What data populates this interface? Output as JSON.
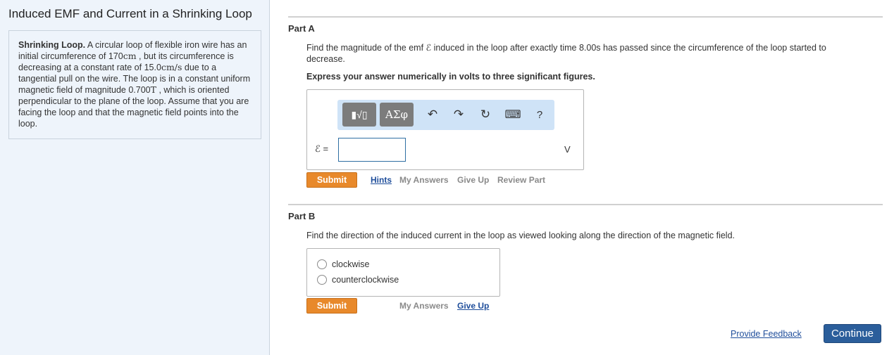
{
  "title": "Induced EMF and Current in a Shrinking Loop",
  "intro": {
    "lead": "Shrinking Loop.",
    "text1": " A circular loop of flexible iron wire has an initial circumference of ",
    "circ_value": "170",
    "circ_unit": "cm",
    "text2": " , but its circumference is decreasing at a constant rate of ",
    "rate_value": "15.0",
    "rate_unit": "cm/s",
    "text3": " due to a tangential pull on the wire. The loop is in a constant uniform magnetic field of magnitude ",
    "field_value": "0.700",
    "field_unit": "T",
    "text4": " , which is oriented perpendicular to the plane of the loop. Assume that you are facing the loop and that the magnetic field points into the loop."
  },
  "partA": {
    "title": "Part A",
    "prompt": "Find the magnitude of the emf ℰ induced in the loop after exactly time 8.00s has passed since the circumference of the loop started to decrease.",
    "instruction": "Express your answer numerically in volts to three significant figures.",
    "toolbar": {
      "template_label": "▮√▯",
      "greek_label": "ΑΣφ",
      "undo": "↶",
      "redo": "↷",
      "reset": "↻",
      "keyboard": "⌨",
      "help": "?"
    },
    "eq_label": "ℰ =",
    "input_value": "",
    "unit": "V",
    "submit": "Submit",
    "links": {
      "hints": "Hints",
      "my_answers": "My Answers",
      "give_up": "Give Up",
      "review_part": "Review Part"
    }
  },
  "partB": {
    "title": "Part B",
    "prompt": "Find the direction of the induced current in the loop as viewed looking along the direction of the magnetic field.",
    "options": [
      "clockwise",
      "counterclockwise"
    ],
    "submit": "Submit",
    "links": {
      "my_answers": "My Answers",
      "give_up": "Give Up"
    }
  },
  "footer": {
    "feedback": "Provide Feedback",
    "continue": "Continue"
  },
  "colors": {
    "accent_orange": "#e8892b",
    "link_blue": "#1f4e9b",
    "button_blue": "#2b5e9b",
    "panel_bg": "#eef4fb",
    "toolbar_bg": "#cfe3f7"
  }
}
